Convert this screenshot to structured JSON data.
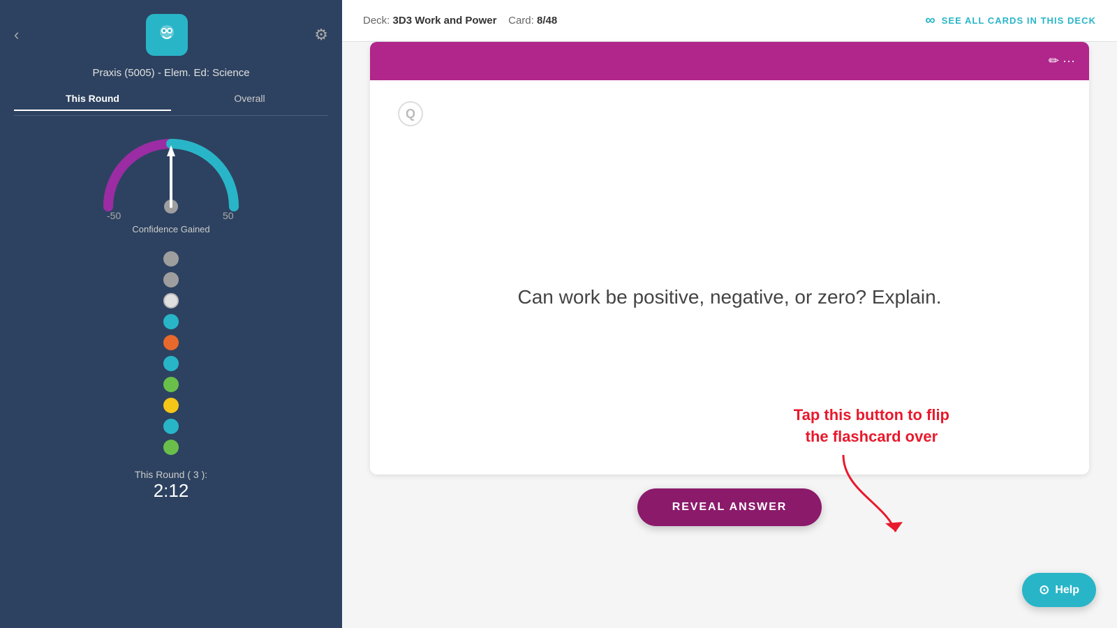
{
  "sidebar": {
    "back_icon": "‹",
    "settings_icon": "⚙",
    "course_title": "Praxis (5005) - Elem. Ed: Science",
    "tabs": [
      {
        "label": "This Round",
        "active": true
      },
      {
        "label": "Overall",
        "active": false
      }
    ],
    "gauge": {
      "min_label": "-50",
      "max_label": "50",
      "title": "Confidence Gained",
      "needle_value": 0
    },
    "dots": [
      {
        "color": "#9e9e9e"
      },
      {
        "color": "#9e9e9e"
      },
      {
        "color": "#e0e0e0"
      },
      {
        "color": "#29b5c8"
      },
      {
        "color": "#e8692c"
      },
      {
        "color": "#29b5c8"
      },
      {
        "color": "#6abf4b"
      },
      {
        "color": "#f5c518"
      },
      {
        "color": "#29b5c8"
      },
      {
        "color": "#6abf4b"
      }
    ],
    "round_label": "This Round ( 3 ):",
    "round_time": "2:12"
  },
  "header": {
    "deck_label": "Deck:",
    "deck_name": "3D3 Work and Power",
    "card_label": "Card:",
    "card_value": "8/48",
    "see_all_label": "SEE ALL CARDS IN THIS DECK"
  },
  "card": {
    "question": "Can work be positive, negative, or zero? Explain.",
    "q_icon": "Q"
  },
  "annotation": {
    "text": "Tap this button to flip\nthe flashcard over"
  },
  "reveal_button": {
    "label": "REVEAL ANSWER"
  },
  "help_button": {
    "label": "Help"
  }
}
